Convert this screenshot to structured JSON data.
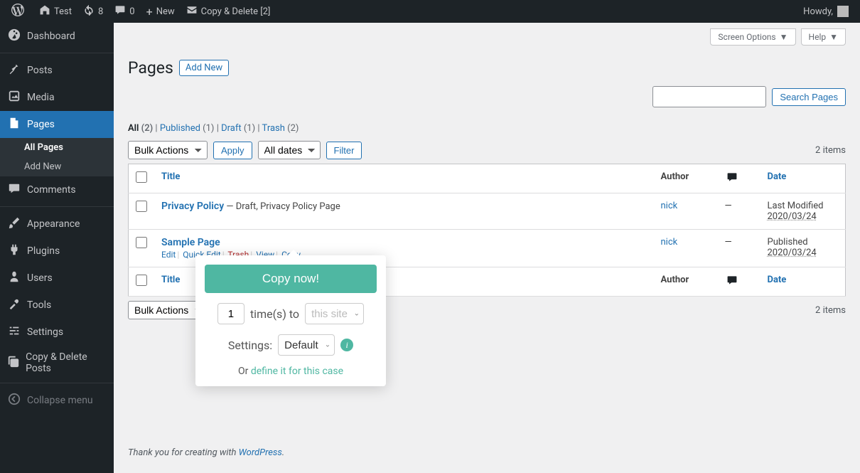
{
  "adminbar": {
    "site": "Test",
    "updates": "8",
    "comments": "0",
    "new": "New",
    "copydel": "Copy & Delete [2]",
    "howdy": "Howdy,"
  },
  "sidebar": {
    "items": [
      {
        "label": "Dashboard"
      },
      {
        "label": "Posts"
      },
      {
        "label": "Media"
      },
      {
        "label": "Pages"
      },
      {
        "label": "Comments"
      },
      {
        "label": "Appearance"
      },
      {
        "label": "Plugins"
      },
      {
        "label": "Users"
      },
      {
        "label": "Tools"
      },
      {
        "label": "Settings"
      },
      {
        "label": "Copy & Delete Posts"
      }
    ],
    "submenu": {
      "all": "All Pages",
      "addnew": "Add New"
    },
    "collapse": "Collapse menu"
  },
  "screen_options": "Screen Options",
  "help": "Help",
  "page_title": "Pages",
  "add_new": "Add New",
  "filters": {
    "all": "All",
    "all_count": "(2)",
    "published": "Published",
    "published_count": "(1)",
    "draft": "Draft",
    "draft_count": "(1)",
    "trash": "Trash",
    "trash_count": "(2)",
    "sep": " | "
  },
  "bulk_actions": "Bulk Actions",
  "apply": "Apply",
  "all_dates": "All dates",
  "filter": "Filter",
  "items_count": "2 items",
  "search_btn": "Search Pages",
  "columns": {
    "title": "Title",
    "author": "Author",
    "date": "Date"
  },
  "rows": [
    {
      "title": "Privacy Policy",
      "meta": " — Draft, Privacy Policy Page",
      "author": "nick",
      "comments": "—",
      "date_label": "Last Modified",
      "date": "2020/03/24"
    },
    {
      "title": "Sample Page",
      "author": "nick",
      "comments": "—",
      "date_label": "Published",
      "date": "2020/03/24",
      "actions": {
        "edit": "Edit",
        "quick": "Quick Edit",
        "trash": "Trash",
        "view": "View",
        "copy": "Copy"
      }
    }
  ],
  "popup": {
    "button": "Copy now!",
    "times": "1",
    "times_label": "time(s) to",
    "site_placeholder": "this site",
    "settings_label": "Settings:",
    "settings_value": "Default",
    "or": "Or ",
    "define": "define it for this case"
  },
  "footer": {
    "text": "Thank you for creating with ",
    "link": "WordPress",
    "dot": "."
  }
}
